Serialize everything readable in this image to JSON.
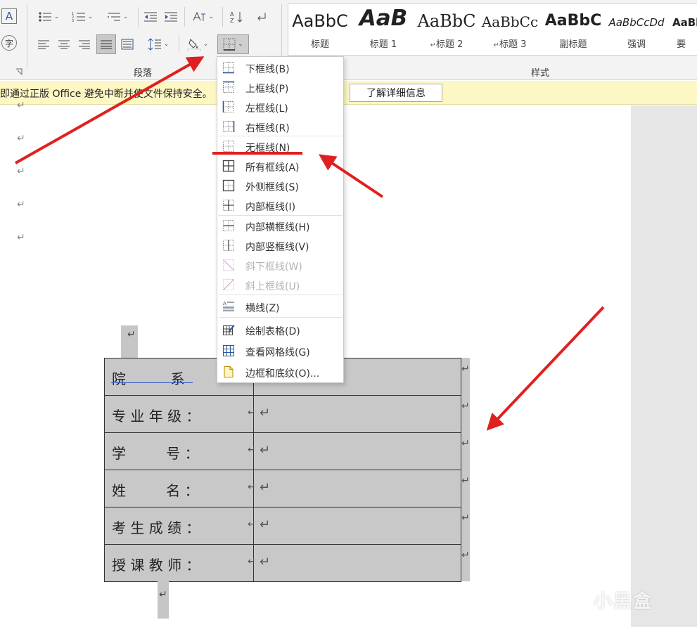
{
  "ribbon": {
    "paragraph_group_label": "段落",
    "styles_group_label": "样式",
    "styles": [
      {
        "sample": "AaBbC",
        "name": "标题"
      },
      {
        "sample": "AaB",
        "name": "标题 1"
      },
      {
        "sample": "AaBbC",
        "name": "标题 2"
      },
      {
        "sample": "AaBbCc",
        "name": "标题 3"
      },
      {
        "sample": "AaBbC",
        "name": "副标题"
      },
      {
        "sample": "AaBbCcDd",
        "name": "强调"
      },
      {
        "sample": "AaBl",
        "name": "要"
      }
    ],
    "font_A_label": "A",
    "phonetic_label": "字"
  },
  "message_bar": {
    "text": "即通过正版 Office 避免中断并使文件保持安全。",
    "button_label": "了解详细信息"
  },
  "border_menu": {
    "items": [
      {
        "label": "下框线(B)",
        "disabled": false
      },
      {
        "label": "上框线(P)",
        "disabled": false
      },
      {
        "label": "左框线(L)",
        "disabled": false
      },
      {
        "label": "右框线(R)",
        "disabled": false
      },
      {
        "label": "无框线(N)",
        "disabled": false
      },
      {
        "label": "所有框线(A)",
        "disabled": false
      },
      {
        "label": "外侧框线(S)",
        "disabled": false
      },
      {
        "label": "内部框线(I)",
        "disabled": false
      },
      {
        "label": "内部横框线(H)",
        "disabled": false
      },
      {
        "label": "内部竖框线(V)",
        "disabled": false
      },
      {
        "label": "斜下框线(W)",
        "disabled": true
      },
      {
        "label": "斜上框线(U)",
        "disabled": true
      },
      {
        "label": "横线(Z)",
        "disabled": false
      },
      {
        "label": "绘制表格(D)",
        "disabled": false
      },
      {
        "label": "查看网格线(G)",
        "disabled": false
      },
      {
        "label": "边框和底纹(O)...",
        "disabled": false
      }
    ]
  },
  "document": {
    "paragraph_mark": "↵",
    "table_rows": [
      {
        "label": "院          系"
      },
      {
        "label": "专 业 年 级 ："
      },
      {
        "label": "学         号 ："
      },
      {
        "label": "姓         名 ："
      },
      {
        "label": "考 生 成 绩 ："
      },
      {
        "label": "授 课 教 师 ："
      }
    ]
  },
  "watermark": "小黑盒",
  "colors": {
    "annotation_red": "#e02020",
    "table_fill": "#c8c8c8",
    "message_bar": "#fdf7c4"
  }
}
